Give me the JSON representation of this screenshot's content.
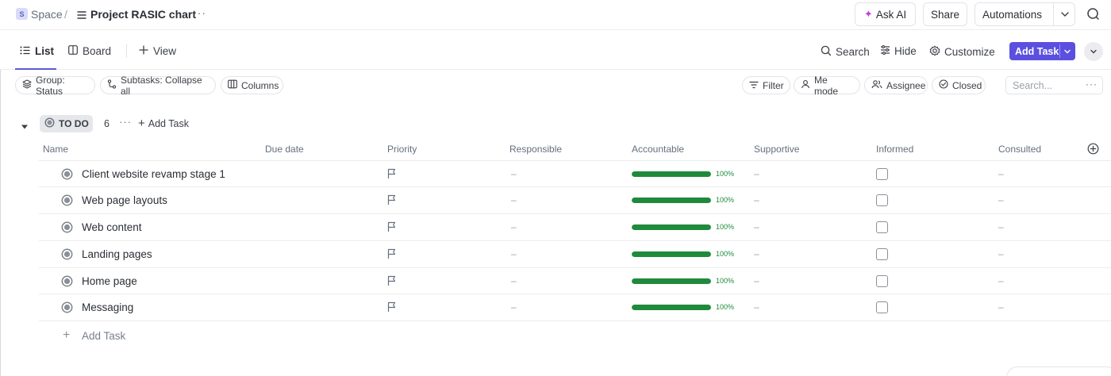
{
  "breadcrumb": {
    "space_badge": "S",
    "space": "Space",
    "separator": "/",
    "title": "Project RASIC chart",
    "more": "···"
  },
  "header": {
    "ask_ai": "Ask AI",
    "share": "Share",
    "automations": "Automations"
  },
  "views": {
    "list": "List",
    "board": "Board",
    "add_view": "View",
    "search": "Search",
    "hide": "Hide",
    "customize": "Customize",
    "add_task": "Add Task"
  },
  "filters": {
    "group": "Group: Status",
    "subtasks": "Subtasks: Collapse all",
    "columns": "Columns",
    "filter": "Filter",
    "me_mode": "Me mode",
    "assignee": "Assignee",
    "closed": "Closed",
    "search_placeholder": "Search...",
    "search_more": "···"
  },
  "group": {
    "status": "TO DO",
    "count": "6",
    "more": "···",
    "add_task": "Add Task"
  },
  "columns": [
    "Name",
    "Due date",
    "Priority",
    "Responsible",
    "Accountable",
    "Supportive",
    "Informed",
    "Consulted"
  ],
  "rows": [
    {
      "name": "Client website revamp stage 1",
      "responsible": "–",
      "progress": 100,
      "progress_label": "100%",
      "supportive": "–",
      "informed_checked": false,
      "consulted": "–"
    },
    {
      "name": "Web page layouts",
      "responsible": "–",
      "progress": 100,
      "progress_label": "100%",
      "supportive": "–",
      "informed_checked": false,
      "consulted": "–"
    },
    {
      "name": "Web content",
      "responsible": "–",
      "progress": 100,
      "progress_label": "100%",
      "supportive": "–",
      "informed_checked": false,
      "consulted": "–"
    },
    {
      "name": "Landing pages",
      "responsible": "–",
      "progress": 100,
      "progress_label": "100%",
      "supportive": "–",
      "informed_checked": false,
      "consulted": "–"
    },
    {
      "name": "Home page",
      "responsible": "–",
      "progress": 100,
      "progress_label": "100%",
      "supportive": "–",
      "informed_checked": false,
      "consulted": "–"
    },
    {
      "name": "Messaging",
      "responsible": "–",
      "progress": 100,
      "progress_label": "100%",
      "supportive": "–",
      "informed_checked": false,
      "consulted": "–"
    }
  ],
  "add_task_row": "Add Task",
  "colors": {
    "accent": "#5b4fe0",
    "progress": "#1f8a3c",
    "ask_ai_spark": "#c043e0"
  },
  "icons": {
    "list": "list-icon",
    "board": "board-icon",
    "search": "search-icon",
    "hide": "sliders-icon",
    "customize": "gear-icon",
    "priority": "flag-icon",
    "status": "status-circle-icon"
  }
}
